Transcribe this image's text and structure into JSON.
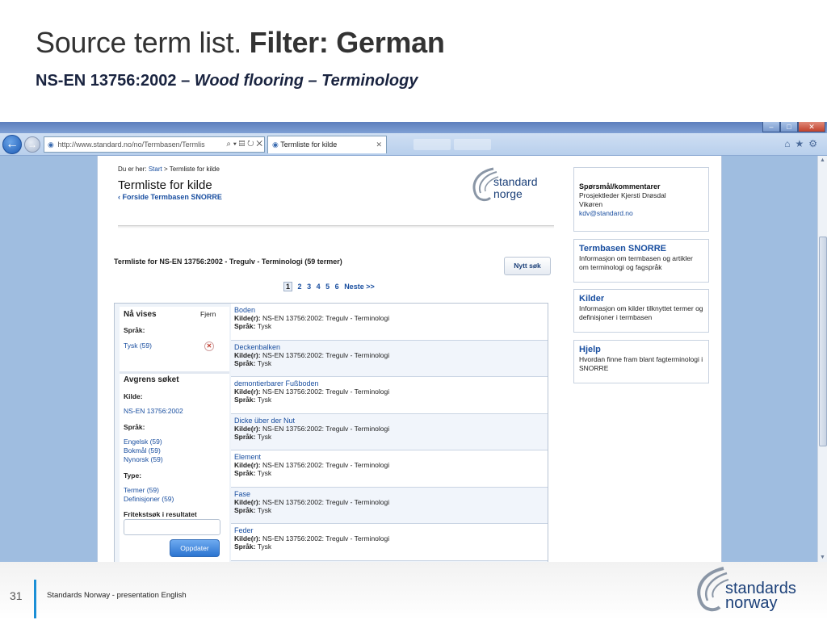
{
  "slide": {
    "title_plain": "Source term list. ",
    "title_bold": "Filter: German",
    "subtitle_plain": "NS-EN 13756:2002 – ",
    "subtitle_italic": "Wood flooring – Terminology",
    "footer_number": "31",
    "footer_text": "Standards Norway - presentation English",
    "footer_logo_line1": "standards",
    "footer_logo_line2": "norway"
  },
  "browser": {
    "address_url": "http://www.standard.no/no/Termbasen/Termlis",
    "tab_label": "Termliste for kilde",
    "icons": [
      "back-arrow-icon",
      "forward-arrow-icon",
      "search-icon",
      "refresh-icon",
      "stop-icon",
      "home-icon",
      "favorites-star-icon",
      "settings-gear-icon"
    ]
  },
  "page": {
    "breadcrumb_prefix": "Du er her:",
    "breadcrumb_start": "Start",
    "breadcrumb_current": "Termliste for kilde",
    "heading": "Termliste for kilde",
    "back_link": "‹ Forside Termbasen SNORRE",
    "logo_line1": "standard",
    "logo_line2": "norge",
    "list_heading": "Termliste for NS-EN 13756:2002 - Tregulv - Terminologi (59 termer)",
    "new_search_button": "Nytt søk",
    "pager": {
      "current": "1",
      "pages": [
        "2",
        "3",
        "4",
        "5",
        "6"
      ],
      "next": "Neste >>"
    }
  },
  "facets": {
    "now_showing": "Nå vises",
    "remove": "Fjern",
    "language_label": "Språk:",
    "active_filter": "Tysk (59)",
    "refine_heading": "Avgrens søket",
    "source_label": "Kilde:",
    "source_value": "NS-EN 13756:2002",
    "language_label2": "Språk:",
    "languages": [
      "Engelsk (59)",
      "Bokmål (59)",
      "Nynorsk (59)"
    ],
    "type_label": "Type:",
    "types": [
      "Termer (59)",
      "Definisjoner (59)"
    ],
    "freetext_label": "Fritekstsøk i resultatet",
    "freetext_value": "",
    "update_button": "Oppdater"
  },
  "results": [
    {
      "term": "Boden",
      "source_label": "Kilde(r):",
      "source": "NS-EN 13756:2002: Tregulv - Terminologi",
      "lang_label": "Språk:",
      "lang": "Tysk"
    },
    {
      "term": "Deckenbalken",
      "source_label": "Kilde(r):",
      "source": "NS-EN 13756:2002: Tregulv - Terminologi",
      "lang_label": "Språk:",
      "lang": "Tysk"
    },
    {
      "term": "demontierbarer Fußboden",
      "source_label": "Kilde(r):",
      "source": "NS-EN 13756:2002: Tregulv - Terminologi",
      "lang_label": "Språk:",
      "lang": "Tysk"
    },
    {
      "term": "Dicke über der Nut",
      "source_label": "Kilde(r):",
      "source": "NS-EN 13756:2002: Tregulv - Terminologi",
      "lang_label": "Språk:",
      "lang": "Tysk"
    },
    {
      "term": "Element",
      "source_label": "Kilde(r):",
      "source": "NS-EN 13756:2002: Tregulv - Terminologi",
      "lang_label": "Språk:",
      "lang": "Tysk"
    },
    {
      "term": "Fase",
      "source_label": "Kilde(r):",
      "source": "NS-EN 13756:2002: Tregulv - Terminologi",
      "lang_label": "Språk:",
      "lang": "Tysk"
    },
    {
      "term": "Feder",
      "source_label": "Kilde(r):",
      "source": "NS-EN 13756:2002: Tregulv - Terminologi",
      "lang_label": "Språk:",
      "lang": "Tysk"
    }
  ],
  "sidebar": {
    "contact_heading": "Spørsmål/kommentarer",
    "contact_line1": "Prosjektleder Kjersti Drøsdal",
    "contact_line2": "Vikøren",
    "contact_email": "kdv@standard.no",
    "boxes": [
      {
        "title": "Termbasen SNORRE",
        "text": "Informasjon om termbasen og artikler om terminologi og fagspråk"
      },
      {
        "title": "Kilder",
        "text": "Informasjon om kilder tilknyttet termer og definisjoner i termbasen"
      },
      {
        "title": "Hjelp",
        "text": "Hvordan finne fram blant fagterminologi i SNORRE"
      }
    ]
  }
}
